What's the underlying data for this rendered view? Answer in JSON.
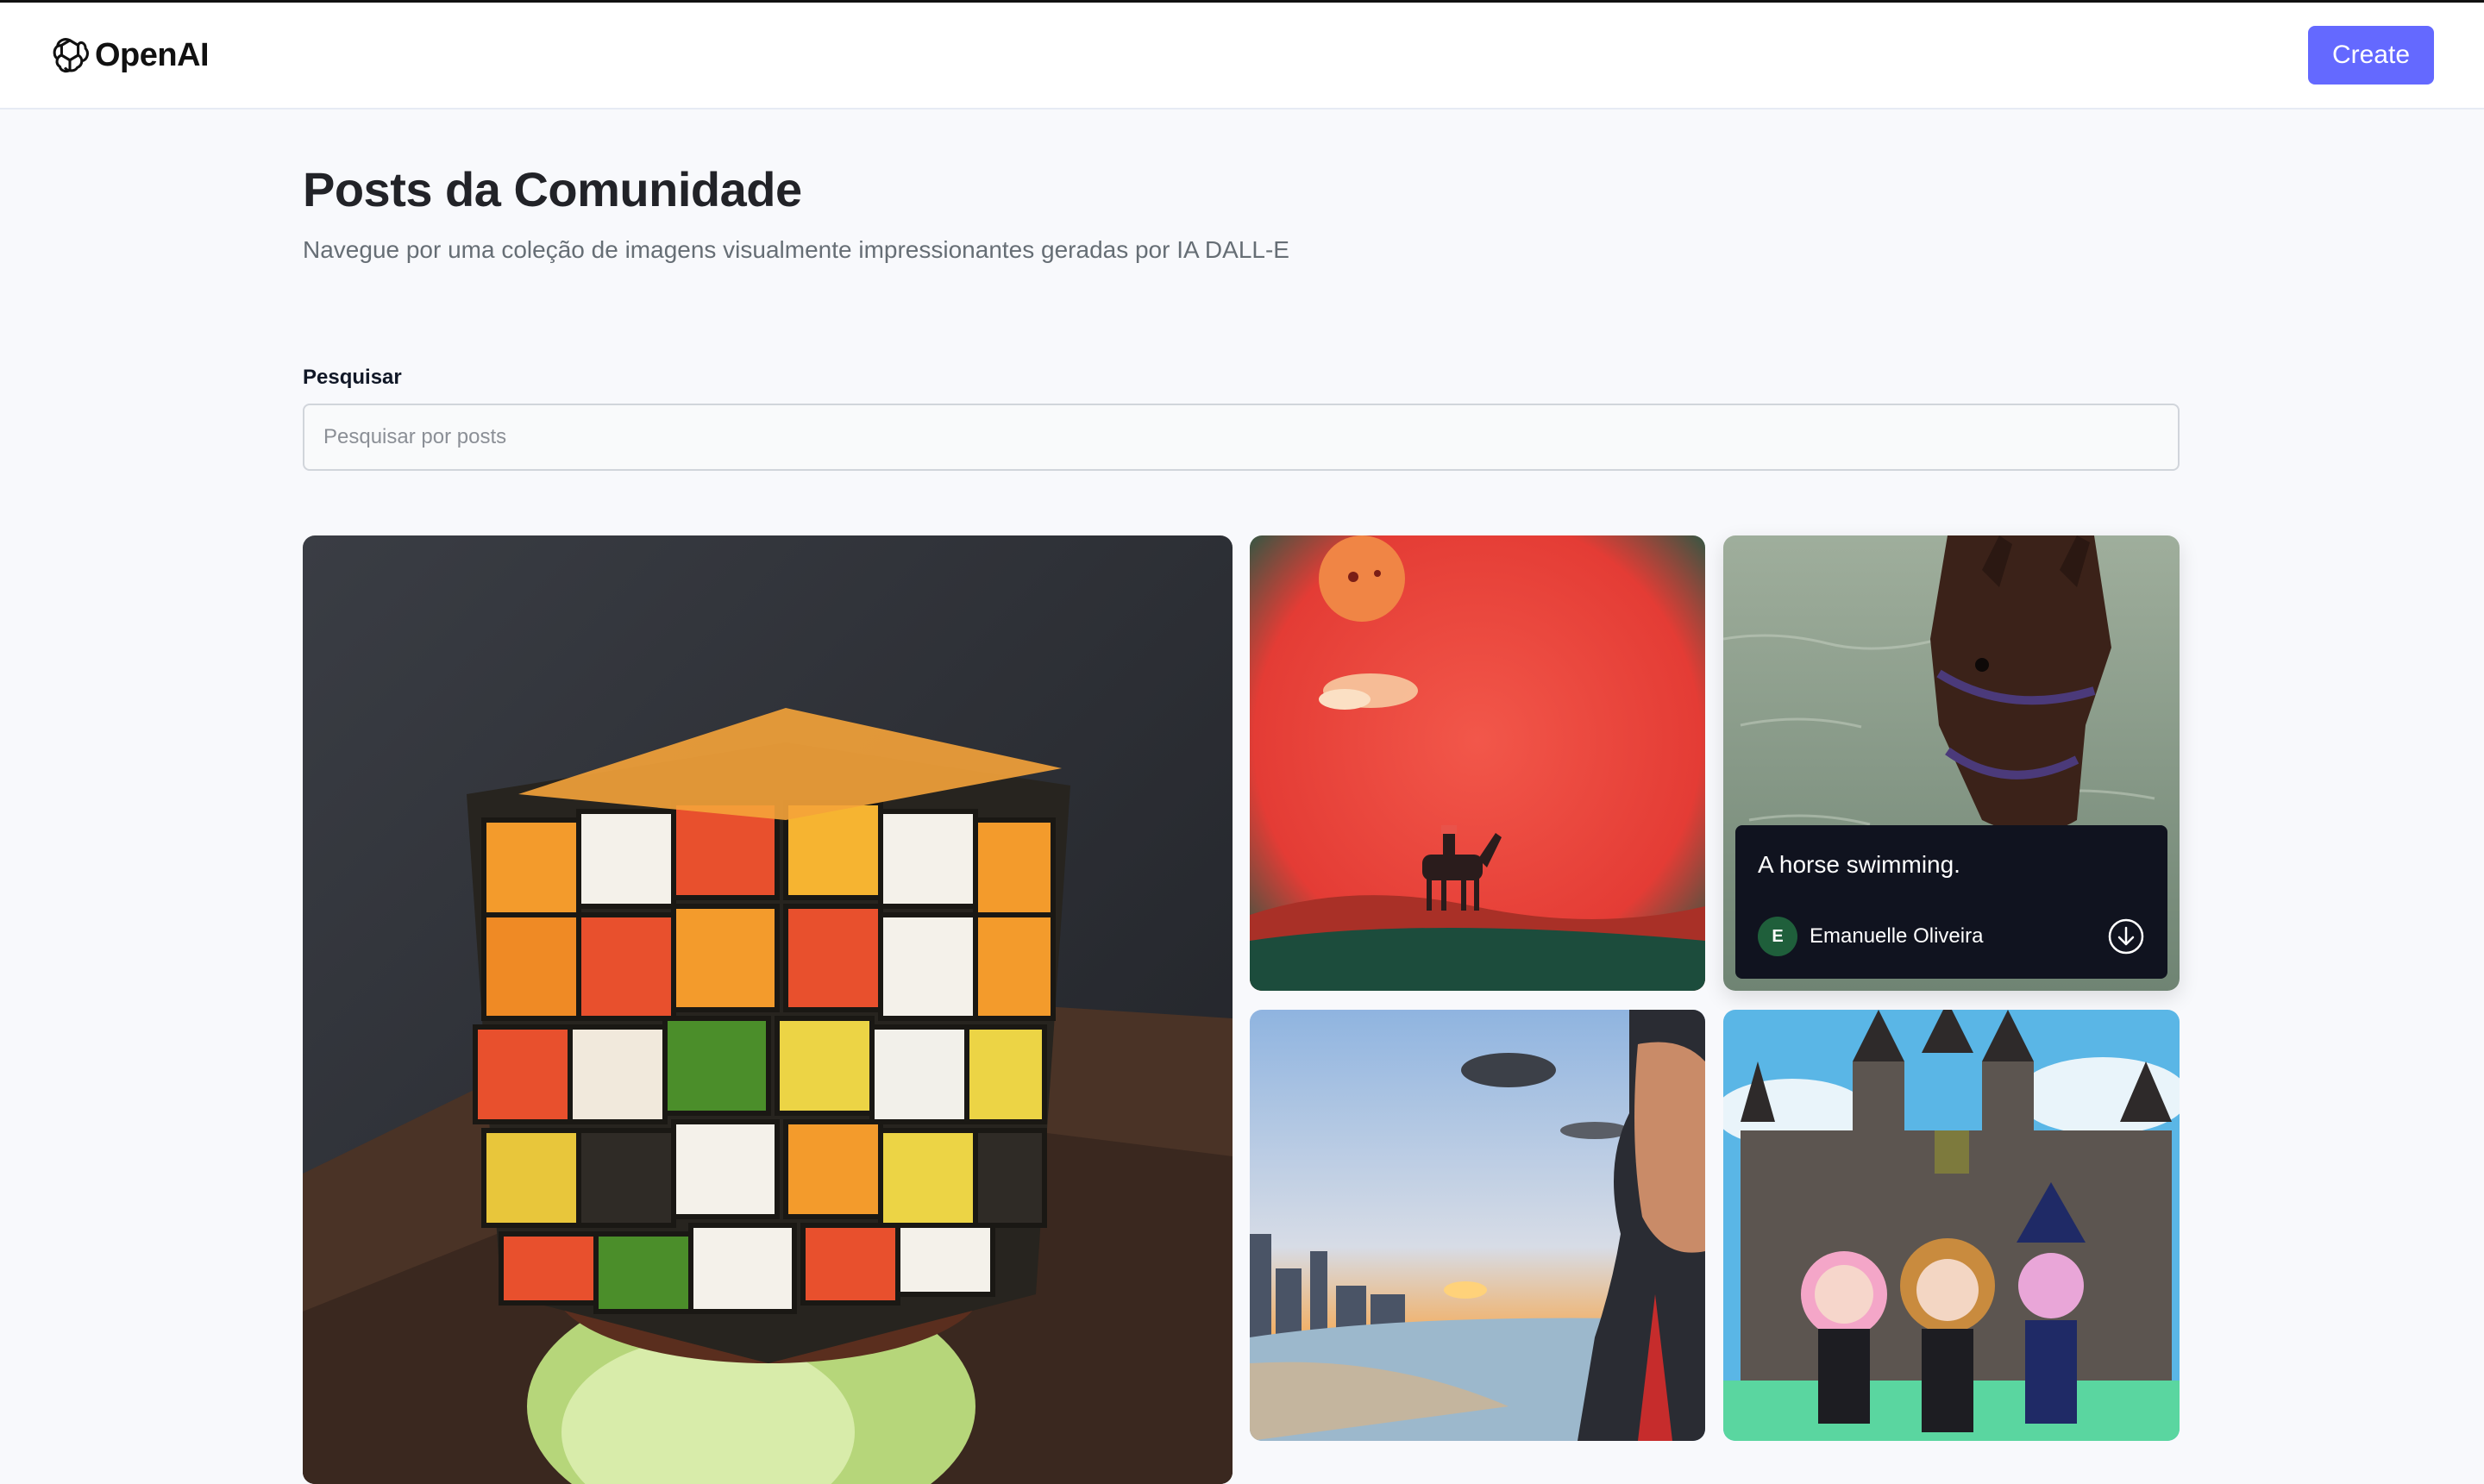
{
  "header": {
    "logo_text": "OpenAI",
    "logo_icon": "openai-logo-icon",
    "create_label": "Create"
  },
  "main": {
    "title": "Posts da Comunidade",
    "subtitle": "Navegue por uma coleção de imagens visualmente impressionantes geradas por IA DALL-E"
  },
  "search": {
    "label": "Pesquisar",
    "placeholder": "Pesquisar por posts",
    "value": ""
  },
  "posts": [
    {
      "id": "rubik-burger"
    },
    {
      "id": "desert-rider"
    },
    {
      "id": "horse",
      "prompt": "A horse swimming.",
      "author": "Emanuelle Oliveira",
      "author_initial": "E",
      "download_icon": "download-icon"
    },
    {
      "id": "beach-man"
    },
    {
      "id": "castle-girls"
    }
  ],
  "colors": {
    "accent": "#6469ff",
    "overlay": "#10131f",
    "avatar": "#1f5f3b",
    "background": "#f8f9fc"
  }
}
